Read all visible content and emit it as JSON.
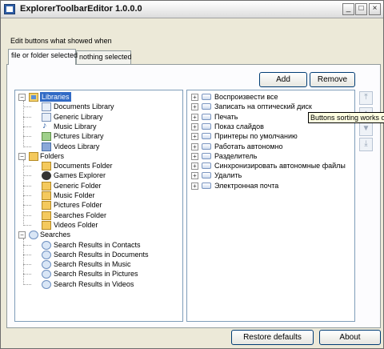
{
  "window": {
    "title": "ExplorerToolbarEditor 1.0.0.0",
    "controls": {
      "minimize": "_",
      "maximize": "□",
      "close": "×"
    }
  },
  "hint": "Edit buttons what showed when",
  "tabs": [
    {
      "label": "file or folder selected",
      "active": true
    },
    {
      "label": "nothing selected",
      "active": false
    }
  ],
  "buttons": {
    "add": "Add",
    "remove": "Remove",
    "restore": "Restore defaults",
    "about": "About"
  },
  "tree": {
    "libraries": {
      "label": "Libraries",
      "children": [
        "Documents Library",
        "Generic Library",
        "Music Library",
        "Pictures Library",
        "Videos Library"
      ]
    },
    "folders": {
      "label": "Folders",
      "children": [
        "Documents Folder",
        "Games Explorer",
        "Generic Folder",
        "Music Folder",
        "Pictures Folder",
        "Searches Folder",
        "Videos Folder"
      ]
    },
    "searches": {
      "label": "Searches",
      "children": [
        "Search Results in Contacts",
        "Search Results in Documents",
        "Search Results in Music",
        "Search Results in Pictures",
        "Search Results in Videos"
      ]
    }
  },
  "commands": [
    "Воспроизвести все",
    "Записать на оптический диск",
    "Печать",
    "Показ слайдов",
    "Принтеры по умолчанию",
    "Работать автономно",
    "Разделитель",
    "Синхронизировать автономные файлы",
    "Удалить",
    "Электронная почта"
  ],
  "sort_buttons": {
    "top": "⤒",
    "up": "▲",
    "down": "▼",
    "bottom": "⤓"
  },
  "tooltip": "Buttons sorting works only"
}
